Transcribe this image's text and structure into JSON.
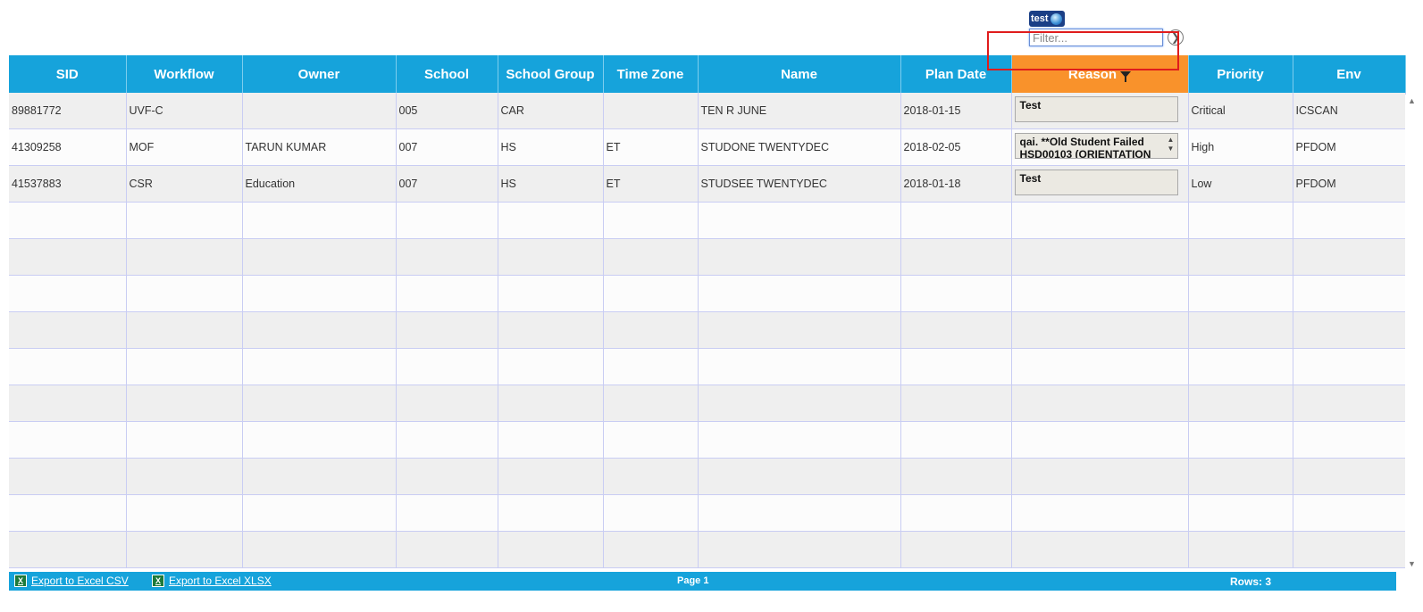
{
  "filter": {
    "tag_label": "test",
    "placeholder": "Filter...",
    "go_icon": "arrow-circle-icon"
  },
  "grid": {
    "columns": [
      {
        "label": "SID"
      },
      {
        "label": "Workflow"
      },
      {
        "label": "Owner"
      },
      {
        "label": "School"
      },
      {
        "label": "School Group"
      },
      {
        "label": "Time Zone"
      },
      {
        "label": "Name"
      },
      {
        "label": "Plan Date"
      },
      {
        "label": "Reason",
        "sorted": true
      },
      {
        "label": "Priority"
      },
      {
        "label": "Env"
      }
    ],
    "rows": [
      {
        "sid": "89881772",
        "workflow": "UVF-C",
        "owner": "",
        "school": "005",
        "school_group": "CAR",
        "time_zone": "",
        "name": "TEN R JUNE",
        "plan_date": "2018-01-15",
        "reason": "Test",
        "priority": "Critical",
        "env": "ICSCAN"
      },
      {
        "sid": "41309258",
        "workflow": "MOF",
        "owner": "TARUN KUMAR",
        "school": "007",
        "school_group": "HS",
        "time_zone": "ET",
        "name": "STUDONE TWENTYDEC",
        "plan_date": "2018-02-05",
        "reason": "qai. **Old Student Failed HSD00103 (ORIENTATION",
        "priority": "High",
        "env": "PFDOM"
      },
      {
        "sid": "41537883",
        "workflow": "CSR",
        "owner": "Education",
        "school": "007",
        "school_group": "HS",
        "time_zone": "ET",
        "name": "STUDSEE TWENTYDEC",
        "plan_date": "2018-01-18",
        "reason": "Test",
        "priority": "Low",
        "env": "PFDOM"
      }
    ],
    "empty_rows": 10
  },
  "footer": {
    "export_csv": "Export to Excel CSV",
    "export_xlsx": "Export to Excel XLSX",
    "page": "Page 1",
    "rows": "Rows: 3"
  },
  "colors": {
    "header": "#16a3db",
    "sorted_header": "#f9922b",
    "highlight": "#e01c1c"
  }
}
